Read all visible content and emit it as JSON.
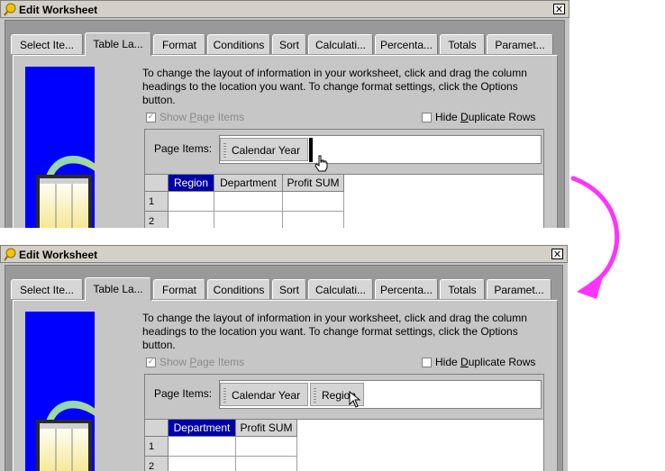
{
  "window": {
    "title": "Edit Worksheet",
    "close_glyph": "✕"
  },
  "tabs": [
    "Select Ite...",
    "Table La...",
    "Format",
    "Conditions",
    "Sort",
    "Calculati...",
    "Percenta...",
    "Totals",
    "Paramet..."
  ],
  "active_tab_index": 1,
  "instructions": "To change the layout of information in your worksheet, click and drag the column headings to the location you want.  To change format settings, click the Options button.",
  "show_page_items": {
    "before": "Show ",
    "mnemonic": "P",
    "after": "age Items",
    "checked": true,
    "enabled": false
  },
  "hide_duplicate_rows": {
    "before": "Hide ",
    "mnemonic": "D",
    "after": "uplicate Rows",
    "checked": false
  },
  "page_items_label": "Page Items:",
  "before": {
    "page_items": [
      "Calendar Year"
    ],
    "columns": [
      "Region",
      "Department",
      "Profit SUM"
    ],
    "selected_column": "Region",
    "rows": [
      "1",
      "2"
    ]
  },
  "after": {
    "page_items": [
      "Calendar Year",
      "Region"
    ],
    "columns": [
      "Department",
      "Profit SUM"
    ],
    "selected_column": "Department",
    "rows": [
      "1",
      "2"
    ]
  },
  "colors": {
    "selected_header": "#0000a8",
    "arrow": "#ff33ff",
    "graphic_blue": "#0000ff"
  },
  "icons": [
    "app-icon",
    "close-icon",
    "hand-cursor-icon",
    "arrow-cursor-icon",
    "checkmark-icon",
    "transition-arrow-icon"
  ]
}
